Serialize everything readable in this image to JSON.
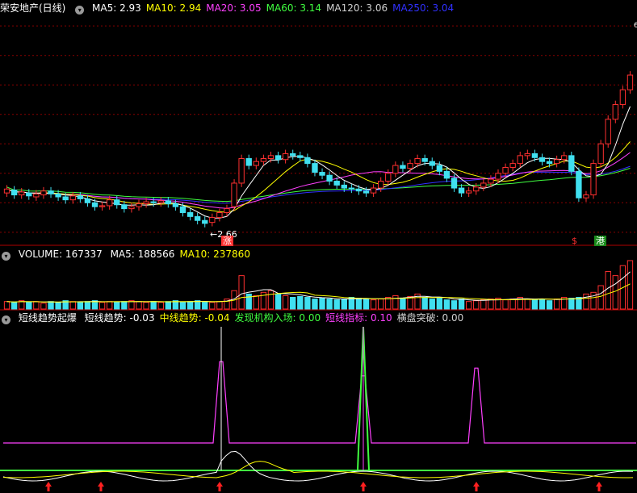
{
  "price_legend": {
    "title": "荣安地产(日线)",
    "items": [
      {
        "label": "MA5: 2.93",
        "color": "#ffffff"
      },
      {
        "label": "MA10: 2.94",
        "color": "#ffff00"
      },
      {
        "label": "MA20: 3.05",
        "color": "#ff40ff"
      },
      {
        "label": "MA60: 3.14",
        "color": "#40ff40"
      },
      {
        "label": "MA120: 3.06",
        "color": "#d0d0d0"
      },
      {
        "label": "MA250: 3.04",
        "color": "#3030ff"
      }
    ]
  },
  "price_annotations": {
    "low_label": "2.66",
    "top_label": "6",
    "tag_zhang": "涨",
    "tag_s": "$",
    "tag_gang": "港"
  },
  "vol_legend": {
    "title": "VOLUME: 167337",
    "items": [
      {
        "label": "MA5: 188566",
        "color": "#ffffff"
      },
      {
        "label": "MA10: 237860",
        "color": "#ffff00"
      }
    ]
  },
  "ind_legend": {
    "title": "短线趋势起爆",
    "items": [
      {
        "label": "短线趋势: -0.03",
        "color": "#ffffff"
      },
      {
        "label": "中线趋势: -0.04",
        "color": "#ffff00"
      },
      {
        "label": "发现机构入场: 0.00",
        "color": "#40ff40"
      },
      {
        "label": "短线指标: 0.10",
        "color": "#ff40ff"
      },
      {
        "label": "横盘突破: 0.00",
        "color": "#d0d0d0"
      }
    ]
  },
  "colors": {
    "up": "#ff3030",
    "down": "#40e0f0",
    "grid": "#8a0000",
    "separator": "#b00000"
  },
  "chart_data": {
    "type": "candlestick",
    "closes": [
      3.04,
      2.98,
      3.01,
      2.97,
      2.99,
      3.02,
      2.99,
      2.96,
      2.93,
      2.97,
      2.94,
      2.9,
      2.86,
      2.87,
      2.93,
      2.88,
      2.84,
      2.86,
      2.89,
      2.91,
      2.9,
      2.92,
      2.89,
      2.86,
      2.8,
      2.76,
      2.72,
      2.69,
      2.75,
      2.8,
      2.84,
      3.1,
      3.35,
      3.28,
      3.32,
      3.35,
      3.38,
      3.34,
      3.4,
      3.38,
      3.36,
      3.3,
      3.21,
      3.18,
      3.12,
      3.08,
      3.05,
      3.04,
      3.02,
      3.0,
      3.05,
      3.12,
      3.2,
      3.28,
      3.25,
      3.3,
      3.35,
      3.32,
      3.28,
      3.22,
      3.15,
      3.05,
      3.0,
      3.02,
      3.06,
      3.1,
      3.14,
      3.2,
      3.26,
      3.3,
      3.38,
      3.4,
      3.36,
      3.32,
      3.3,
      3.34,
      3.38,
      3.22,
      2.95,
      2.98,
      3.3,
      3.5,
      3.75,
      3.9,
      4.05,
      4.2
    ],
    "opens": [
      3.0,
      3.03,
      2.98,
      3.0,
      2.96,
      2.98,
      3.02,
      2.99,
      2.96,
      2.93,
      2.97,
      2.94,
      2.9,
      2.86,
      2.87,
      2.93,
      2.88,
      2.84,
      2.86,
      2.89,
      2.91,
      2.9,
      2.92,
      2.89,
      2.86,
      2.8,
      2.76,
      2.72,
      2.7,
      2.75,
      2.8,
      2.86,
      3.1,
      3.35,
      3.28,
      3.32,
      3.35,
      3.38,
      3.34,
      3.4,
      3.38,
      3.36,
      3.3,
      3.21,
      3.18,
      3.12,
      3.08,
      3.05,
      3.04,
      3.02,
      3.0,
      3.05,
      3.12,
      3.2,
      3.28,
      3.25,
      3.3,
      3.35,
      3.32,
      3.28,
      3.22,
      3.15,
      3.05,
      3.0,
      3.02,
      3.06,
      3.1,
      3.14,
      3.2,
      3.26,
      3.3,
      3.38,
      3.4,
      3.36,
      3.32,
      3.3,
      3.34,
      3.38,
      3.22,
      2.95,
      2.98,
      3.3,
      3.5,
      3.75,
      3.9,
      4.05
    ],
    "volumes": [
      9,
      8,
      10,
      8,
      9,
      7,
      9,
      8,
      10,
      9,
      8,
      9,
      10,
      8,
      9,
      8,
      9,
      10,
      9,
      8,
      9,
      8,
      9,
      10,
      8,
      9,
      10,
      9,
      8,
      9,
      12,
      22,
      40,
      18,
      16,
      20,
      22,
      18,
      16,
      14,
      15,
      14,
      12,
      13,
      12,
      11,
      12,
      14,
      13,
      12,
      11,
      12,
      14,
      16,
      13,
      15,
      18,
      14,
      12,
      13,
      11,
      10,
      12,
      9,
      10,
      11,
      12,
      13,
      11,
      12,
      14,
      12,
      11,
      12,
      10,
      12,
      14,
      13,
      14,
      18,
      20,
      28,
      45,
      40,
      52,
      58
    ],
    "ylim": [
      2.5,
      4.8
    ]
  }
}
